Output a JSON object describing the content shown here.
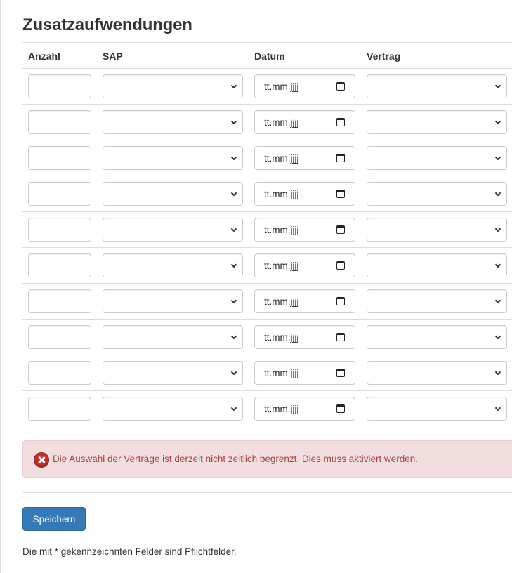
{
  "page": {
    "title": "Zusatzaufwendungen"
  },
  "table": {
    "columns": [
      "Anzahl",
      "SAP",
      "Datum",
      "Vertrag"
    ],
    "date_placeholder": "tt.mm.jjjj",
    "row_count": 10,
    "rows": [
      {
        "anzahl": "",
        "sap": "",
        "datum": "",
        "vertrag": ""
      },
      {
        "anzahl": "",
        "sap": "",
        "datum": "",
        "vertrag": ""
      },
      {
        "anzahl": "",
        "sap": "",
        "datum": "",
        "vertrag": ""
      },
      {
        "anzahl": "",
        "sap": "",
        "datum": "",
        "vertrag": ""
      },
      {
        "anzahl": "",
        "sap": "",
        "datum": "",
        "vertrag": ""
      },
      {
        "anzahl": "",
        "sap": "",
        "datum": "",
        "vertrag": ""
      },
      {
        "anzahl": "",
        "sap": "",
        "datum": "",
        "vertrag": ""
      },
      {
        "anzahl": "",
        "sap": "",
        "datum": "",
        "vertrag": ""
      },
      {
        "anzahl": "",
        "sap": "",
        "datum": "",
        "vertrag": ""
      },
      {
        "anzahl": "",
        "sap": "",
        "datum": "",
        "vertrag": ""
      }
    ]
  },
  "alert": {
    "icon": "error-x-icon",
    "message": "Die Auswahl der Verträge ist derzeit nicht zeitlich begrenzt. Dies muss aktiviert werden."
  },
  "actions": {
    "save_label": "Speichern"
  },
  "footnote": "Die mit * gekennzeichnten Felder sind Pflichtfelder.",
  "colors": {
    "primary": "#337ab7",
    "alert_bg": "#f2dede",
    "alert_text": "#a94442",
    "border": "#cccccc"
  }
}
